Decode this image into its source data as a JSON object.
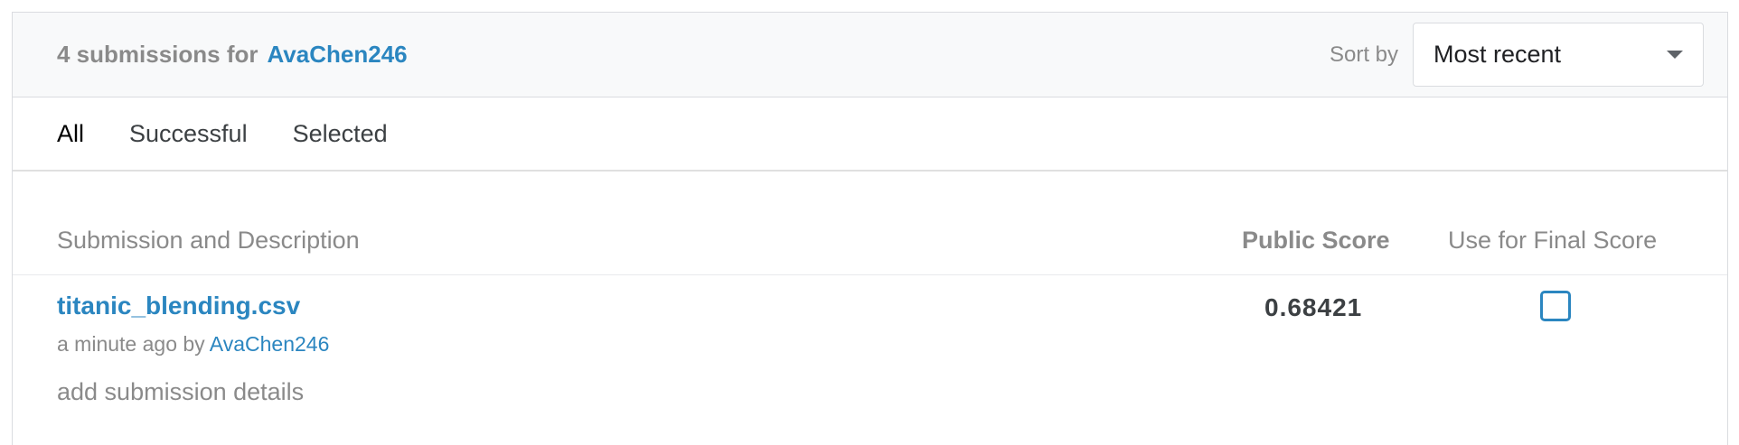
{
  "header": {
    "count_text": "4 submissions for",
    "user": "AvaChen246",
    "sort_label": "Sort by",
    "sort_value": "Most recent"
  },
  "tabs": [
    {
      "label": "All",
      "active": true
    },
    {
      "label": "Successful",
      "active": false
    },
    {
      "label": "Selected",
      "active": false
    }
  ],
  "table": {
    "columns": [
      "Submission and Description",
      "Public Score",
      "Use for Final Score"
    ],
    "rows": [
      {
        "filename": "titanic_blending.csv",
        "time": "a minute ago by",
        "user": "AvaChen246",
        "details_link": "add submission details",
        "public_score": "0.68421",
        "use_for_final": false
      }
    ]
  },
  "colors": {
    "link": "#2b86c0",
    "muted": "#8a8a8a",
    "header_bg": "#f8f9fa"
  }
}
